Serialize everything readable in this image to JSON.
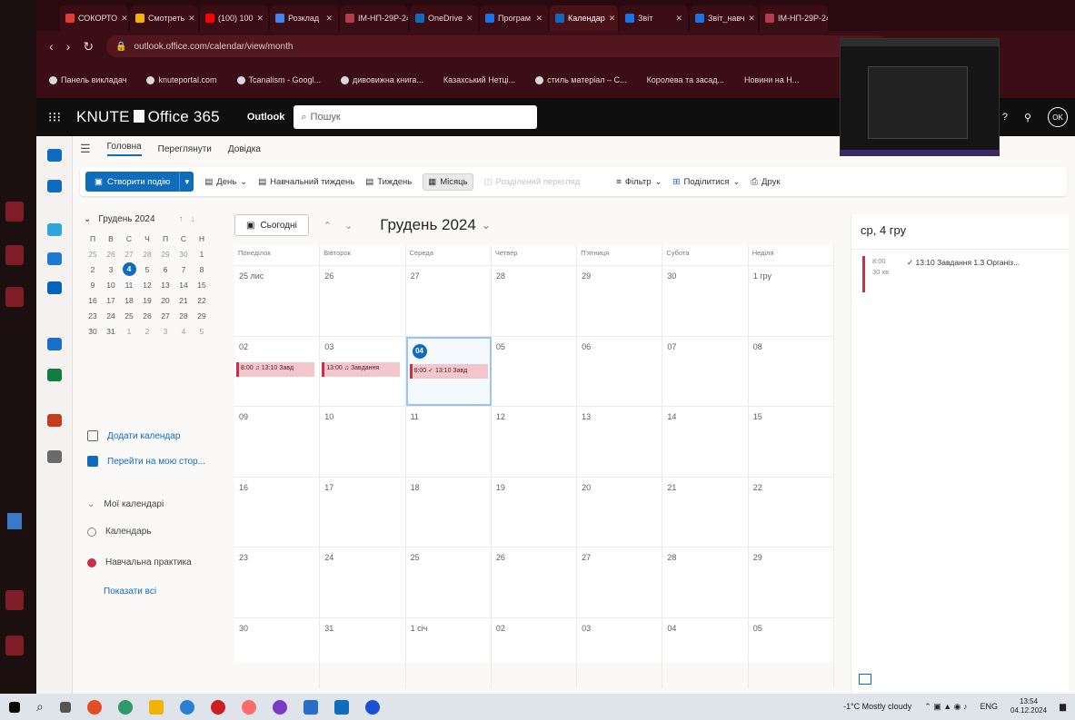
{
  "browser": {
    "tabs": [
      "СОКОРТО",
      "Смотреть",
      "(100) 100",
      "Розклад",
      "ІМ-НП-29Р-24",
      "OneDrive",
      "Програм",
      "Календар",
      "Звіт",
      "Звіт_навч",
      "ІМ-НП-29Р-24"
    ],
    "url": "outlook.office.com/calendar/view/month",
    "bookmarks": [
      "Панель викладач",
      "knuteportal.com",
      "Tcanalism - Googl...",
      "дивовижна книга...",
      "Казахський Нетці...",
      "стиль матеріал – С...",
      "Королева та засад...",
      "Новини на Н..."
    ]
  },
  "o365": {
    "brand_prefix": "KNUTE",
    "brand_suffix": "Office 365",
    "app": "Outlook",
    "search_placeholder": "Пошук",
    "avatar": "OK"
  },
  "ribbon": {
    "tabs": [
      "Головна",
      "Переглянути",
      "Довідка"
    ],
    "new_event": "Створити подію",
    "day": "День",
    "workweek": "Навчальний тиждень",
    "week": "Тиждень",
    "month": "Місяць",
    "split": "Розділений перегляд",
    "filter": "Фільтр",
    "share": "Поділитися",
    "print": "Друк"
  },
  "sidebar": {
    "month_title": "Грудень 2024",
    "weekdays": [
      "П",
      "В",
      "С",
      "Ч",
      "П",
      "С",
      "Н"
    ],
    "weeks": [
      [
        "25",
        "26",
        "27",
        "28",
        "29",
        "30",
        "1"
      ],
      [
        "2",
        "3",
        "4",
        "5",
        "6",
        "7",
        "8"
      ],
      [
        "9",
        "10",
        "11",
        "12",
        "13",
        "14",
        "15"
      ],
      [
        "16",
        "17",
        "18",
        "19",
        "20",
        "21",
        "22"
      ],
      [
        "23",
        "24",
        "25",
        "26",
        "27",
        "28",
        "29"
      ],
      [
        "30",
        "31",
        "1",
        "2",
        "3",
        "4",
        "5"
      ]
    ],
    "add_calendar": "Додати календар",
    "go_to_my": "Перейти на мою стор...",
    "my_calendars": "Мої календарі",
    "calendars": [
      "Календарь",
      "Навчальна практика"
    ],
    "show_all": "Показати всі"
  },
  "calendar": {
    "today_button": "Сьогодні",
    "month_title": "Грудень 2024",
    "days_of_week": [
      "Понеділок",
      "Вівторок",
      "Середа",
      "Четвер",
      "П'ятниця",
      "Субота",
      "Неділя"
    ],
    "weeks": [
      [
        "25 лис",
        "26",
        "27",
        "28",
        "29",
        "30",
        "1 гру"
      ],
      [
        "02",
        "03",
        "04",
        "05",
        "06",
        "07",
        "08"
      ],
      [
        "09",
        "10",
        "11",
        "12",
        "13",
        "14",
        "15"
      ],
      [
        "16",
        "17",
        "18",
        "19",
        "20",
        "21",
        "22"
      ],
      [
        "23",
        "24",
        "25",
        "26",
        "27",
        "28",
        "29"
      ],
      [
        "30",
        "31",
        "1 січ",
        "02",
        "03",
        "04",
        "05"
      ]
    ],
    "events": [
      {
        "text": "8:00 ♫ 13:10 Завд"
      },
      {
        "text": "13:00 ♫ Завдання"
      },
      {
        "text": "8:00 ✓ 13:10 Завд"
      }
    ]
  },
  "agenda": {
    "title": "ср, 4 гру",
    "time": "8:00",
    "duration": "30 хв",
    "event": "✓ 13:10 Завдання 1.3 Організ..."
  },
  "taskbar": {
    "weather": "-1°C Mostly cloudy",
    "lang": "ENG",
    "time": "13:54",
    "date": "04.12.2024"
  },
  "colors": {
    "accent": "#0f6cbd",
    "event": "#c4314b",
    "event_bg": "#f1c7cc",
    "browser": "#3a0e14"
  }
}
